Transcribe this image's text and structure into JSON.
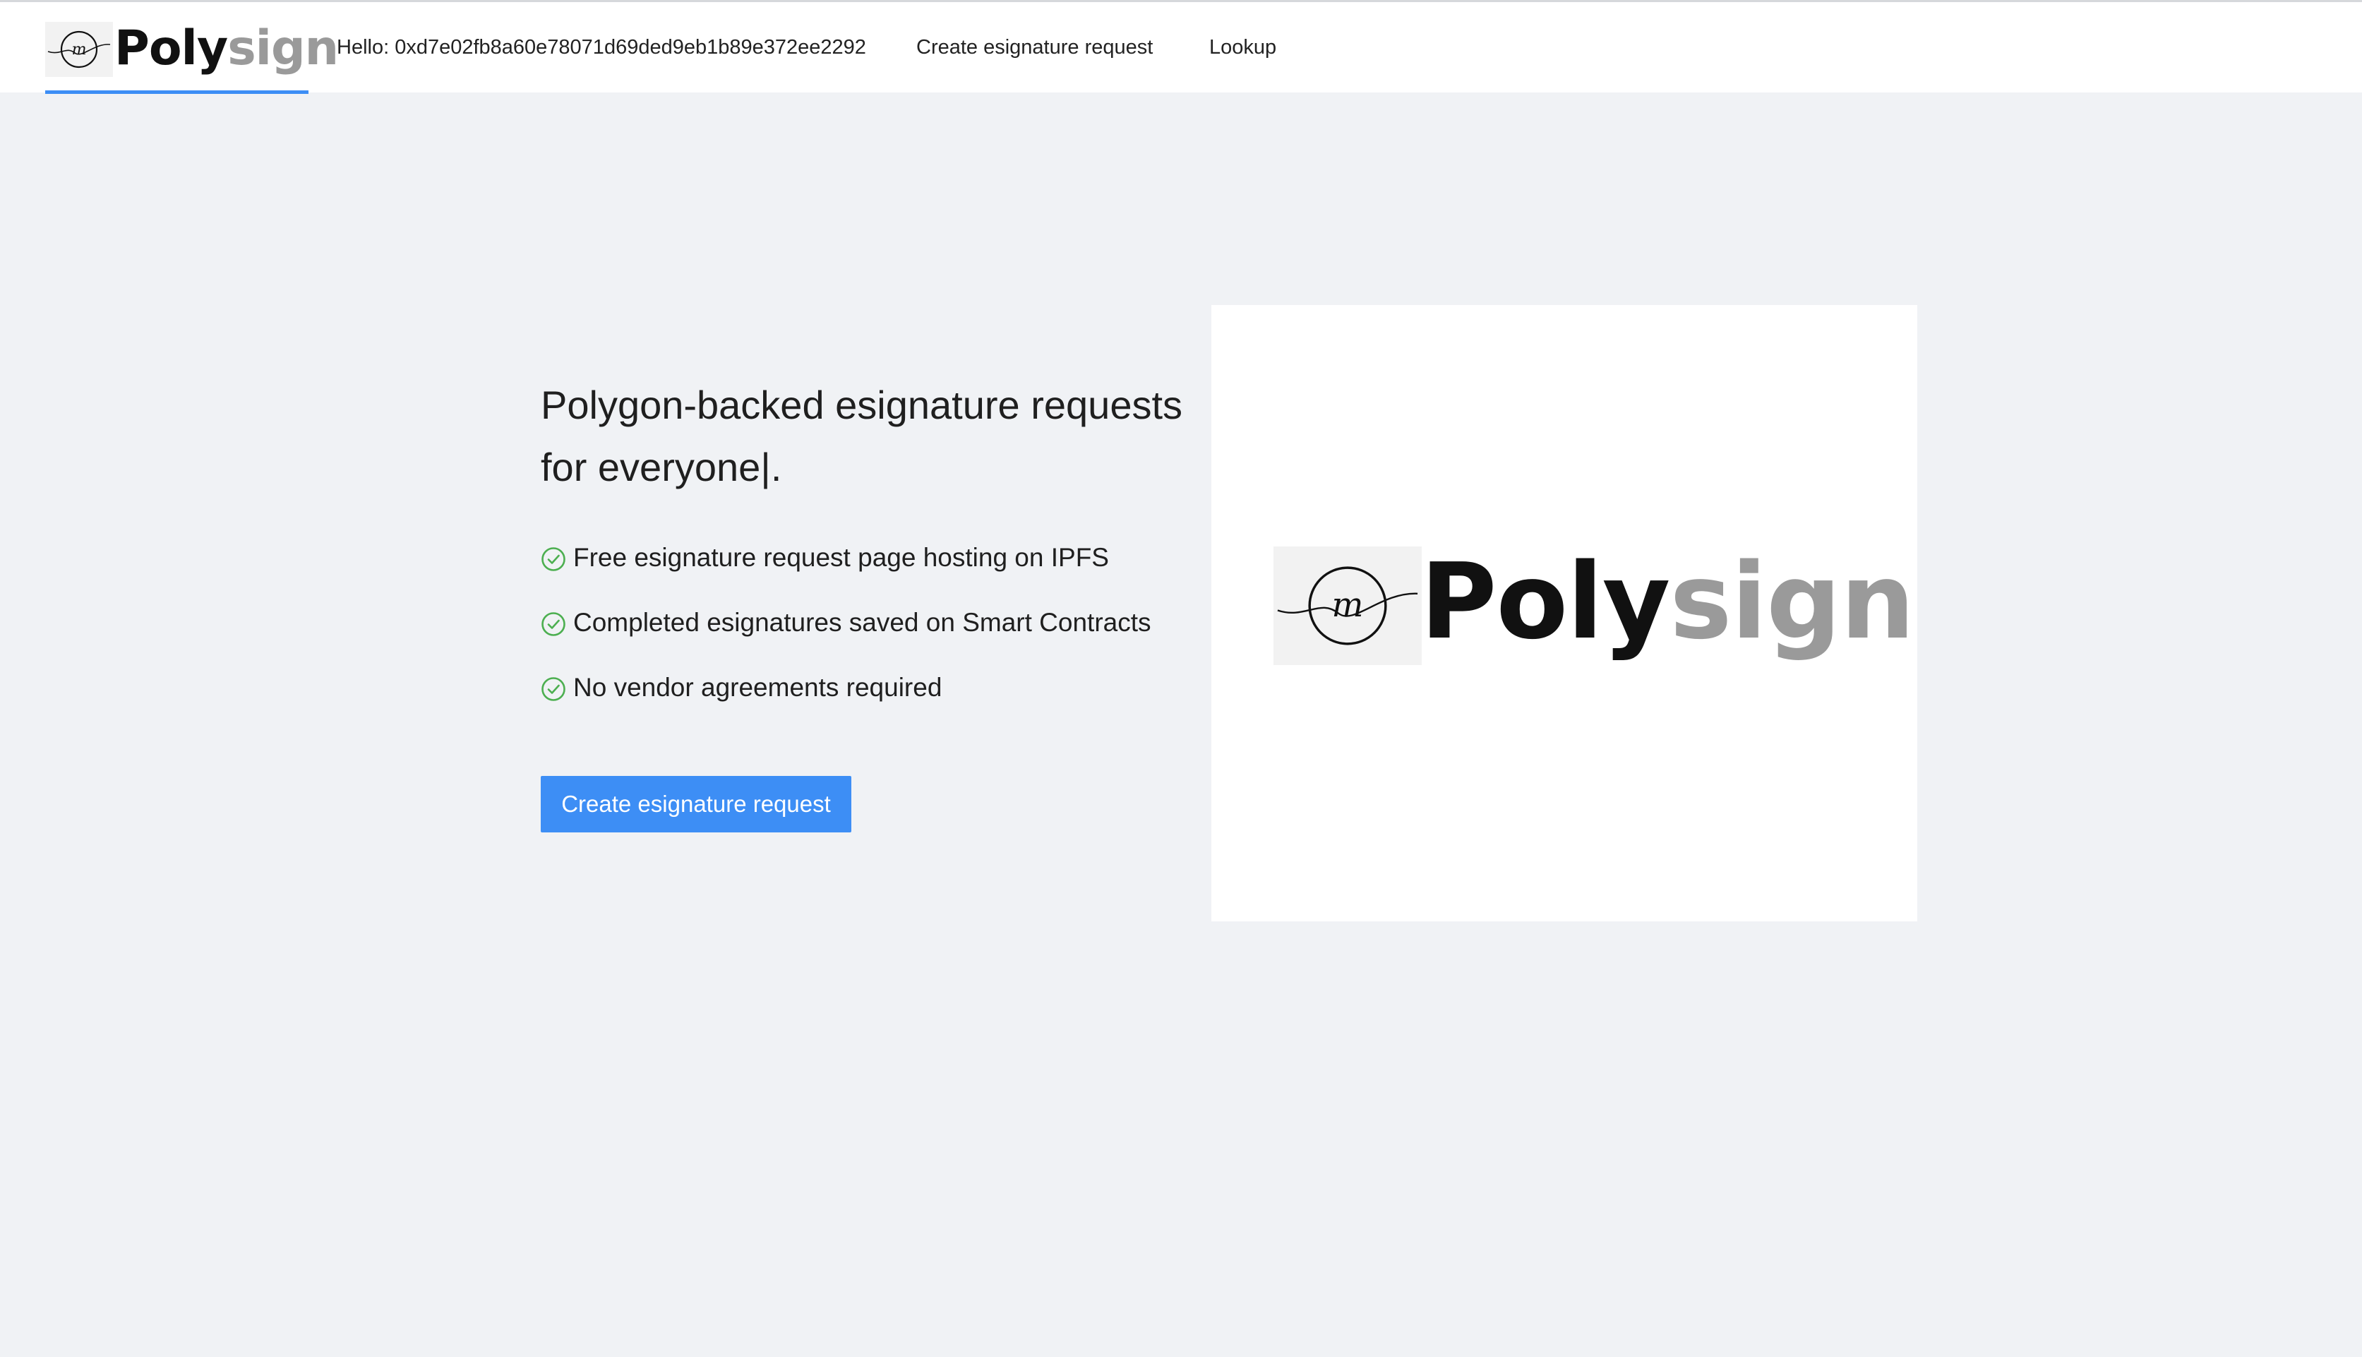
{
  "brand": {
    "name_part1": "Poly",
    "name_part2": "sign",
    "mark_letter": "m",
    "colors": {
      "primary": "#3d8ef5",
      "wordmark_dark": "#111111",
      "wordmark_light": "#9a9a9a",
      "check": "#4caf50"
    }
  },
  "nav": {
    "greeting": "Hello: 0xd7e02fb8a60e78071d69ded9eb1b89e372ee2292",
    "create_label": "Create esignature request",
    "lookup_label": "Lookup"
  },
  "hero": {
    "title": "Polygon-backed esignature requests for everyone|.",
    "features": [
      {
        "icon": "check-circle-icon",
        "text": "Free esignature request page hosting on IPFS"
      },
      {
        "icon": "check-circle-icon",
        "text": "Completed esignatures saved on Smart Contracts"
      },
      {
        "icon": "check-circle-icon",
        "text": "No vendor agreements required"
      }
    ],
    "cta_label": "Create esignature request"
  }
}
